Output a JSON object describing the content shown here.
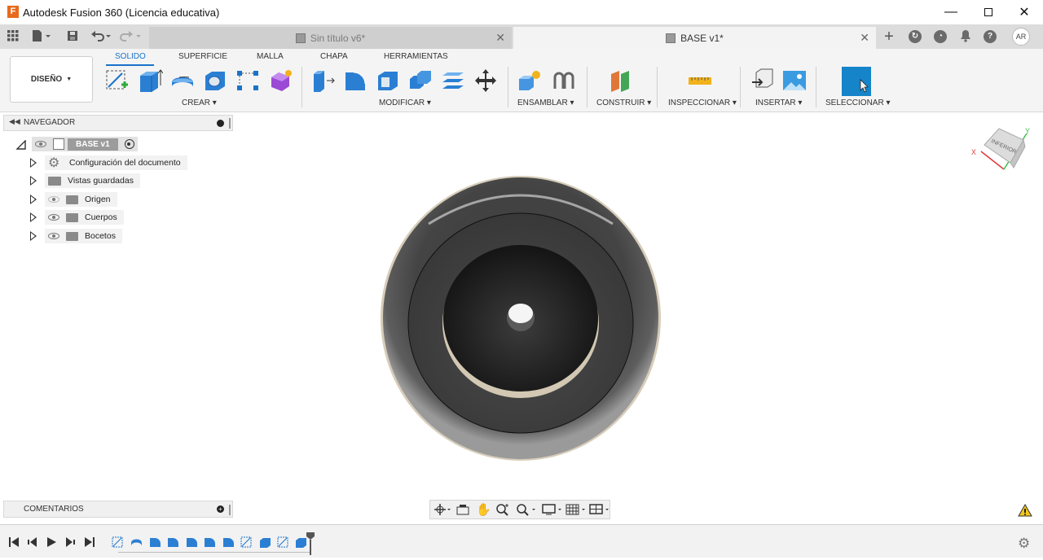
{
  "window": {
    "title": "Autodesk Fusion 360 (Licencia educativa)",
    "logo_letter": "F"
  },
  "tabs": [
    {
      "label": "Sin título v6*",
      "active": false
    },
    {
      "label": "BASE v1*",
      "active": true
    }
  ],
  "user": {
    "initials": "AR"
  },
  "workspace": {
    "label": "DISEÑO"
  },
  "modes": [
    "SOLIDO",
    "SUPERFICIE",
    "MALLA",
    "CHAPA",
    "HERRAMIENTAS"
  ],
  "groups": {
    "crear": "CREAR",
    "modificar": "MODIFICAR",
    "ensamblar": "ENSAMBLAR",
    "construir": "CONSTRUIR",
    "inspeccionar": "INSPECCIONAR",
    "insertar": "INSERTAR",
    "seleccionar": "SELECCIONAR"
  },
  "navigator": {
    "title": "NAVEGADOR",
    "root": "BASE v1",
    "items": [
      {
        "label": "Configuración del documento",
        "icon": "gear-icon"
      },
      {
        "label": "Vistas guardadas",
        "icon": "folder-icon"
      },
      {
        "label": "Origen",
        "icon": "folder-icon",
        "visibility": "hidden"
      },
      {
        "label": "Cuerpos",
        "icon": "folder-icon",
        "visibility": "visible"
      },
      {
        "label": "Bocetos",
        "icon": "folder-icon",
        "visibility": "visible"
      }
    ]
  },
  "comments": {
    "title": "COMENTARIOS"
  },
  "viewcube": {
    "face": "INFERIOR",
    "axis_x": "X",
    "axis_y": "Y"
  },
  "colors": {
    "accent": "#1a73c8",
    "select_tool": "#1584c9",
    "model_body": "#4a4a4a",
    "model_rim": "#cfc6b3"
  }
}
